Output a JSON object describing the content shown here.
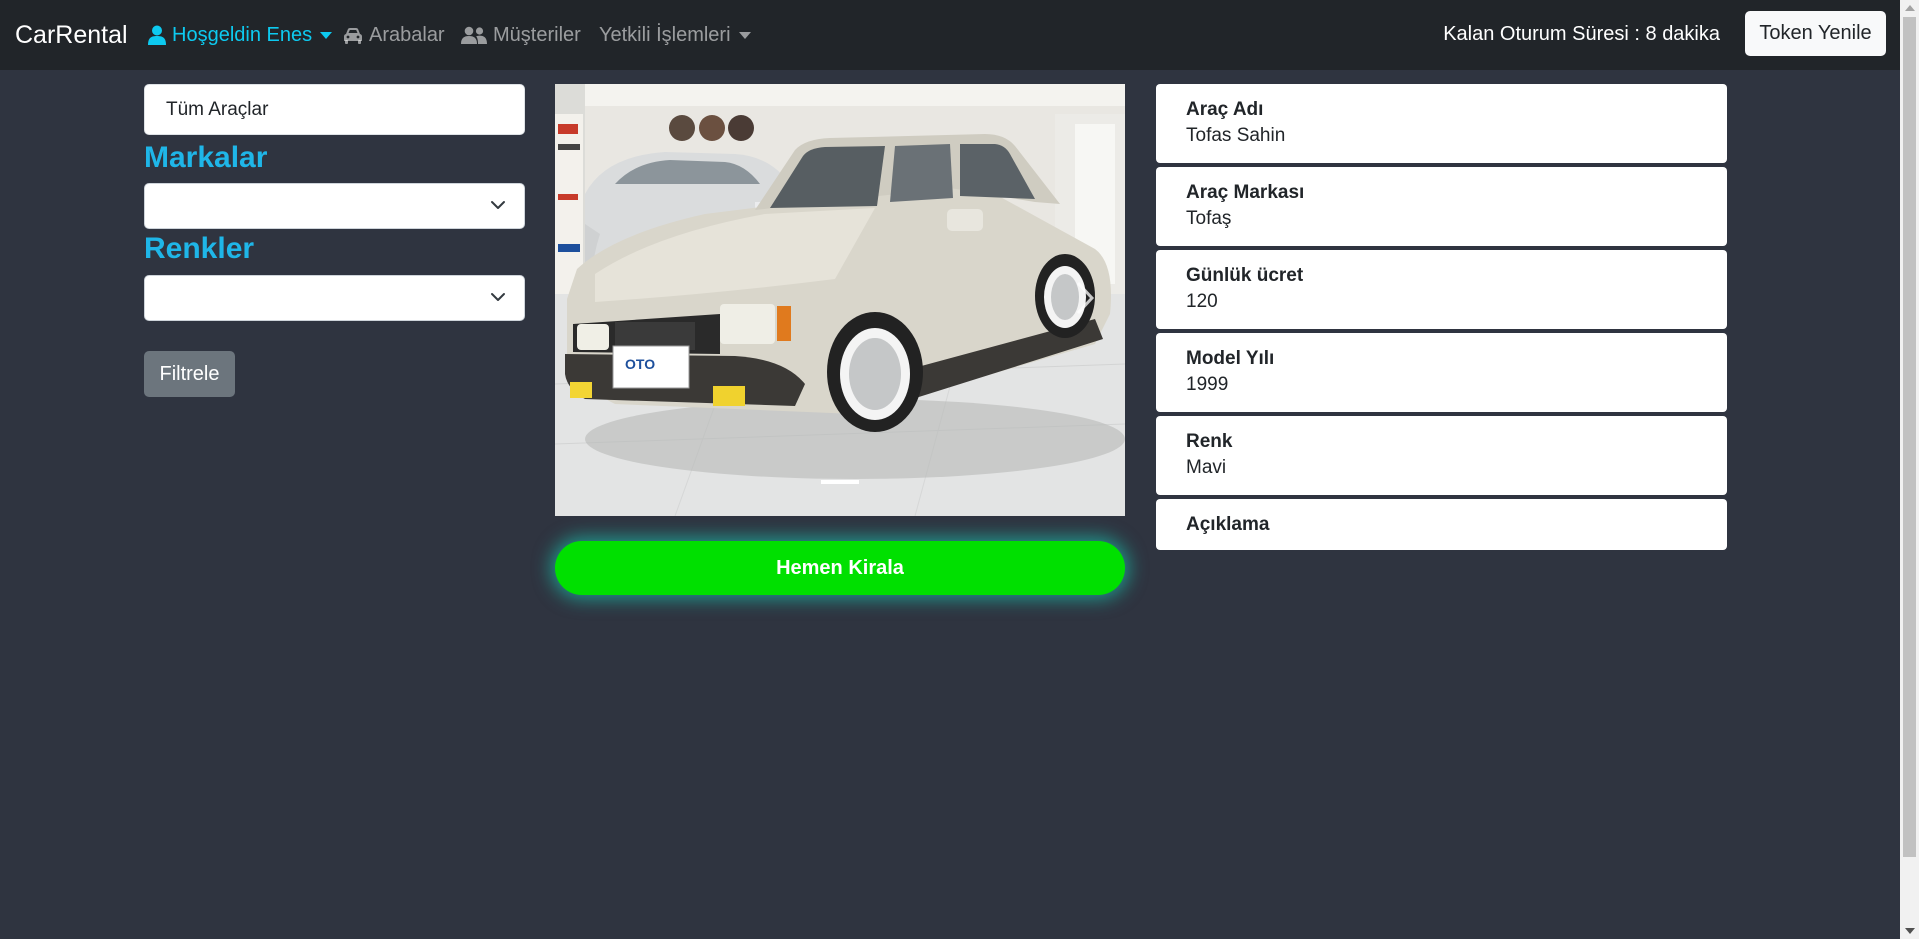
{
  "navbar": {
    "brand": "CarRental",
    "user_menu": "Hoşgeldin Enes",
    "cars_link": "Arabalar",
    "customers_link": "Müşteriler",
    "admin_menu": "Yetkili İşlemleri",
    "session_text": "Kalan Oturum Süresi : 8 dakika",
    "token_button": "Token Yenile"
  },
  "filter": {
    "all_cars": "Tüm Araçlar",
    "brands_title": "Markalar",
    "colors_title": "Renkler",
    "brand_selected": "",
    "color_selected": "",
    "filter_button": "Filtrele"
  },
  "carousel": {
    "plate_text": "OTO"
  },
  "rent_button": "Hemen Kirala",
  "details": [
    {
      "label": "Araç Adı",
      "value": "Tofas Sahin"
    },
    {
      "label": "Araç Markası",
      "value": "Tofaş"
    },
    {
      "label": "Günlük ücret",
      "value": "120"
    },
    {
      "label": "Model Yılı",
      "value": "1999"
    },
    {
      "label": "Renk",
      "value": "Mavi"
    },
    {
      "label": "Açıklama",
      "value": ""
    }
  ],
  "colors": {
    "navbar_bg": "#212529",
    "page_bg": "#2f3440",
    "accent": "#1fb6e8",
    "active_link": "#0dcaf0",
    "rent_button": "#00e000"
  }
}
